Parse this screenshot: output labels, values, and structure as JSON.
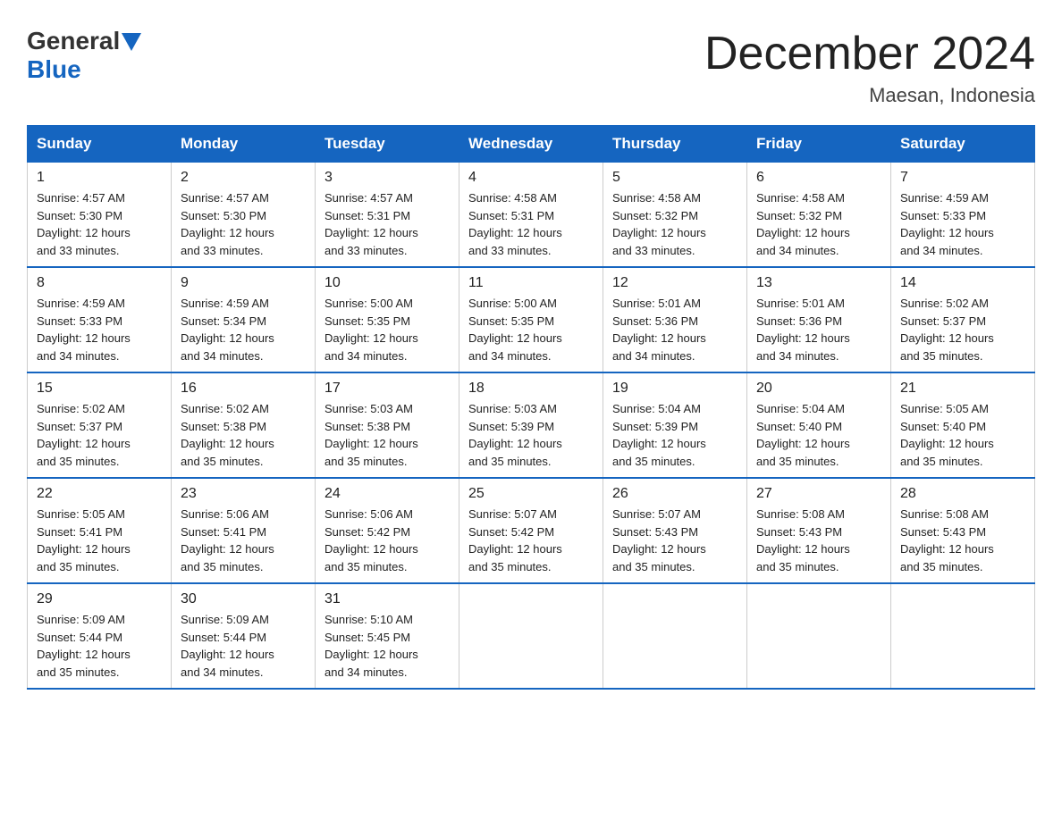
{
  "header": {
    "logo_general": "General",
    "logo_blue": "Blue",
    "month_title": "December 2024",
    "location": "Maesan, Indonesia"
  },
  "calendar": {
    "days_of_week": [
      "Sunday",
      "Monday",
      "Tuesday",
      "Wednesday",
      "Thursday",
      "Friday",
      "Saturday"
    ],
    "weeks": [
      [
        {
          "day": "1",
          "sunrise": "4:57 AM",
          "sunset": "5:30 PM",
          "daylight": "12 hours and 33 minutes."
        },
        {
          "day": "2",
          "sunrise": "4:57 AM",
          "sunset": "5:30 PM",
          "daylight": "12 hours and 33 minutes."
        },
        {
          "day": "3",
          "sunrise": "4:57 AM",
          "sunset": "5:31 PM",
          "daylight": "12 hours and 33 minutes."
        },
        {
          "day": "4",
          "sunrise": "4:58 AM",
          "sunset": "5:31 PM",
          "daylight": "12 hours and 33 minutes."
        },
        {
          "day": "5",
          "sunrise": "4:58 AM",
          "sunset": "5:32 PM",
          "daylight": "12 hours and 33 minutes."
        },
        {
          "day": "6",
          "sunrise": "4:58 AM",
          "sunset": "5:32 PM",
          "daylight": "12 hours and 34 minutes."
        },
        {
          "day": "7",
          "sunrise": "4:59 AM",
          "sunset": "5:33 PM",
          "daylight": "12 hours and 34 minutes."
        }
      ],
      [
        {
          "day": "8",
          "sunrise": "4:59 AM",
          "sunset": "5:33 PM",
          "daylight": "12 hours and 34 minutes."
        },
        {
          "day": "9",
          "sunrise": "4:59 AM",
          "sunset": "5:34 PM",
          "daylight": "12 hours and 34 minutes."
        },
        {
          "day": "10",
          "sunrise": "5:00 AM",
          "sunset": "5:35 PM",
          "daylight": "12 hours and 34 minutes."
        },
        {
          "day": "11",
          "sunrise": "5:00 AM",
          "sunset": "5:35 PM",
          "daylight": "12 hours and 34 minutes."
        },
        {
          "day": "12",
          "sunrise": "5:01 AM",
          "sunset": "5:36 PM",
          "daylight": "12 hours and 34 minutes."
        },
        {
          "day": "13",
          "sunrise": "5:01 AM",
          "sunset": "5:36 PM",
          "daylight": "12 hours and 34 minutes."
        },
        {
          "day": "14",
          "sunrise": "5:02 AM",
          "sunset": "5:37 PM",
          "daylight": "12 hours and 35 minutes."
        }
      ],
      [
        {
          "day": "15",
          "sunrise": "5:02 AM",
          "sunset": "5:37 PM",
          "daylight": "12 hours and 35 minutes."
        },
        {
          "day": "16",
          "sunrise": "5:02 AM",
          "sunset": "5:38 PM",
          "daylight": "12 hours and 35 minutes."
        },
        {
          "day": "17",
          "sunrise": "5:03 AM",
          "sunset": "5:38 PM",
          "daylight": "12 hours and 35 minutes."
        },
        {
          "day": "18",
          "sunrise": "5:03 AM",
          "sunset": "5:39 PM",
          "daylight": "12 hours and 35 minutes."
        },
        {
          "day": "19",
          "sunrise": "5:04 AM",
          "sunset": "5:39 PM",
          "daylight": "12 hours and 35 minutes."
        },
        {
          "day": "20",
          "sunrise": "5:04 AM",
          "sunset": "5:40 PM",
          "daylight": "12 hours and 35 minutes."
        },
        {
          "day": "21",
          "sunrise": "5:05 AM",
          "sunset": "5:40 PM",
          "daylight": "12 hours and 35 minutes."
        }
      ],
      [
        {
          "day": "22",
          "sunrise": "5:05 AM",
          "sunset": "5:41 PM",
          "daylight": "12 hours and 35 minutes."
        },
        {
          "day": "23",
          "sunrise": "5:06 AM",
          "sunset": "5:41 PM",
          "daylight": "12 hours and 35 minutes."
        },
        {
          "day": "24",
          "sunrise": "5:06 AM",
          "sunset": "5:42 PM",
          "daylight": "12 hours and 35 minutes."
        },
        {
          "day": "25",
          "sunrise": "5:07 AM",
          "sunset": "5:42 PM",
          "daylight": "12 hours and 35 minutes."
        },
        {
          "day": "26",
          "sunrise": "5:07 AM",
          "sunset": "5:43 PM",
          "daylight": "12 hours and 35 minutes."
        },
        {
          "day": "27",
          "sunrise": "5:08 AM",
          "sunset": "5:43 PM",
          "daylight": "12 hours and 35 minutes."
        },
        {
          "day": "28",
          "sunrise": "5:08 AM",
          "sunset": "5:43 PM",
          "daylight": "12 hours and 35 minutes."
        }
      ],
      [
        {
          "day": "29",
          "sunrise": "5:09 AM",
          "sunset": "5:44 PM",
          "daylight": "12 hours and 35 minutes."
        },
        {
          "day": "30",
          "sunrise": "5:09 AM",
          "sunset": "5:44 PM",
          "daylight": "12 hours and 34 minutes."
        },
        {
          "day": "31",
          "sunrise": "5:10 AM",
          "sunset": "5:45 PM",
          "daylight": "12 hours and 34 minutes."
        },
        null,
        null,
        null,
        null
      ]
    ]
  }
}
